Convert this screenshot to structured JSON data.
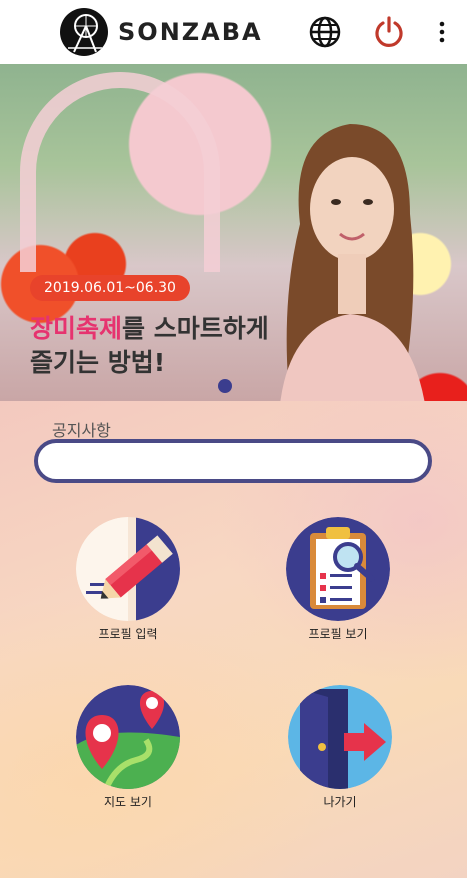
{
  "header": {
    "logo_text": "SONZABA",
    "globe_icon": "globe-icon",
    "power_icon": "power-icon",
    "more_icon": "more-vert-icon"
  },
  "banner": {
    "date_range": "2019.06.01~06.30",
    "title_highlight": "장미축제",
    "title_rest_line1": "를 스마트하게",
    "title_line2": "즐기는 방법!",
    "active_slide": 1,
    "slide_count": 1
  },
  "notice": {
    "label": "공지사항",
    "value": ""
  },
  "menu": [
    {
      "label": "프로필 입력",
      "icon": "pencil-icon"
    },
    {
      "label": "프로필 보기",
      "icon": "clipboard-search-icon"
    },
    {
      "label": "지도 보기",
      "icon": "map-pin-icon"
    },
    {
      "label": "나가기",
      "icon": "exit-door-icon"
    }
  ],
  "colors": {
    "accent": "#4a4a86",
    "date_pill": "#e8432b",
    "title_highlight": "#e6336f",
    "power": "#c0392b"
  }
}
